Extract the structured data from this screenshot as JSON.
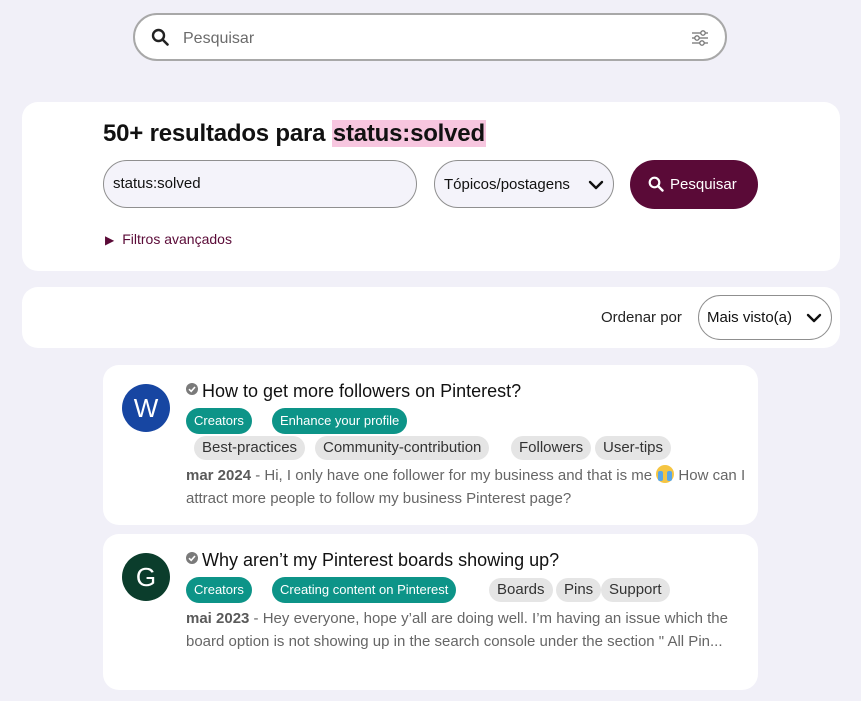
{
  "search": {
    "placeholder": "Pesquisar",
    "icon": "search-icon",
    "filter_icon": "filter-sliders-icon"
  },
  "results": {
    "title_prefix": "50+ resultados para ",
    "title_query": "status:solved",
    "query_value": "status:solved",
    "type_selected": "Tópicos/postagens",
    "search_button": "Pesquisar",
    "advanced_filters": "Filtros avançados"
  },
  "sort": {
    "label": "Ordenar por",
    "selected": "Mais visto(a)"
  },
  "colors": {
    "accent": "#5a0a37",
    "chip_green": "#0d9488",
    "highlight": "#f7c6df"
  },
  "posts": [
    {
      "avatar_letter": "W",
      "avatar_color": "#1746a2",
      "title": "How to get more followers on Pinterest?",
      "green_tags": [
        "Creators",
        "Enhance your profile"
      ],
      "grey_tags": [
        "Best-practices",
        "Community-contribution",
        "Followers",
        "User-tips"
      ],
      "date": "mar 2024",
      "snippet_a": " - Hi, I only have one follower for my business and that is me ",
      "emoji": "loudly-crying-face-icon",
      "snippet_b": " How can I attract more people to follow my business Pinterest page?"
    },
    {
      "avatar_letter": "G",
      "avatar_color": "#0b3d2c",
      "title": "Why aren’t my Pinterest boards showing up?",
      "green_tags": [
        "Creators",
        "Creating content on Pinterest"
      ],
      "grey_tags": [
        "Boards",
        "Pins",
        "Support"
      ],
      "date": "mai 2023",
      "snippet_a": " - Hey everyone, hope y’all are doing well. I’m having an issue which the board option is not showing up in the search console under the section \" All Pin..."
    }
  ]
}
